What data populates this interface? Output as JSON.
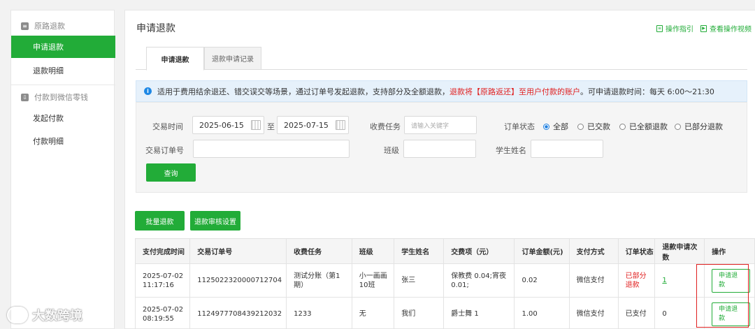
{
  "sidebar": {
    "group1": {
      "label": "原路退款"
    },
    "items1": [
      {
        "label": "申请退款"
      },
      {
        "label": "退款明细"
      }
    ],
    "group2": {
      "label": "付款到微信零钱"
    },
    "items2": [
      {
        "label": "发起付款"
      },
      {
        "label": "付款明细"
      }
    ]
  },
  "header": {
    "title": "申请退款",
    "guide_link": "操作指引",
    "video_link": "查看操作视频"
  },
  "tabs": [
    {
      "label": "申请退款"
    },
    {
      "label": "退款申请记录"
    }
  ],
  "notice": {
    "part1": "适用于费用结余退还、错交误交等场景，通过订单号发起退款，支持部分及全额退款，",
    "part2": "退款将【原路返还】至用户付款的账户",
    "part3": "。可申请退款时间：每天 6:00～21:30"
  },
  "filter": {
    "trade_time_label": "交易时间",
    "date_from": "2025-06-15",
    "date_sep": "至",
    "date_to": "2025-07-15",
    "task_label": "收费任务",
    "task_placeholder": "请输入关键字",
    "status_label": "订单状态",
    "status_options": [
      "全部",
      "已交款",
      "已全额退款",
      "已部分退款"
    ],
    "status_selected": "全部",
    "order_label": "交易订单号",
    "order_value": "",
    "class_label": "班级",
    "class_value": "",
    "student_label": "学生姓名",
    "student_value": "",
    "query_button": "查询"
  },
  "actions": {
    "batch_refund": "批量退款",
    "review_settings": "退款审核设置"
  },
  "table": {
    "headers": [
      "支付完成时间",
      "交易订单号",
      "收费任务",
      "班级",
      "学生姓名",
      "交费项（元）",
      "订单金额(元)",
      "支付方式",
      "订单状态",
      "退款申请次数",
      "操作"
    ],
    "rows": [
      {
        "time": "2025-07-02 11:17:16",
        "order": "1125022320000712704",
        "task": "测试分账（第1期）",
        "class": "小一画画10班",
        "student": "张三",
        "items": "保教费 0.04;宵夜 0.01;",
        "amount": "0.02",
        "pay": "微信支付",
        "status": "已部分退款",
        "count": "1",
        "op": "申请退款"
      },
      {
        "time": "2025-07-02 08:19:55",
        "order": "1124977708439212032",
        "task": "1233",
        "class": "无",
        "student": "我们",
        "items": "爵士舞 1",
        "amount": "1.00",
        "pay": "微信支付",
        "status": "已支付",
        "count": "0",
        "op": "申请退款"
      }
    ]
  },
  "watermark": "大数跨境",
  "colors": {
    "primary": "#22ac38",
    "danger": "#e02020",
    "info": "#1e88e5"
  }
}
